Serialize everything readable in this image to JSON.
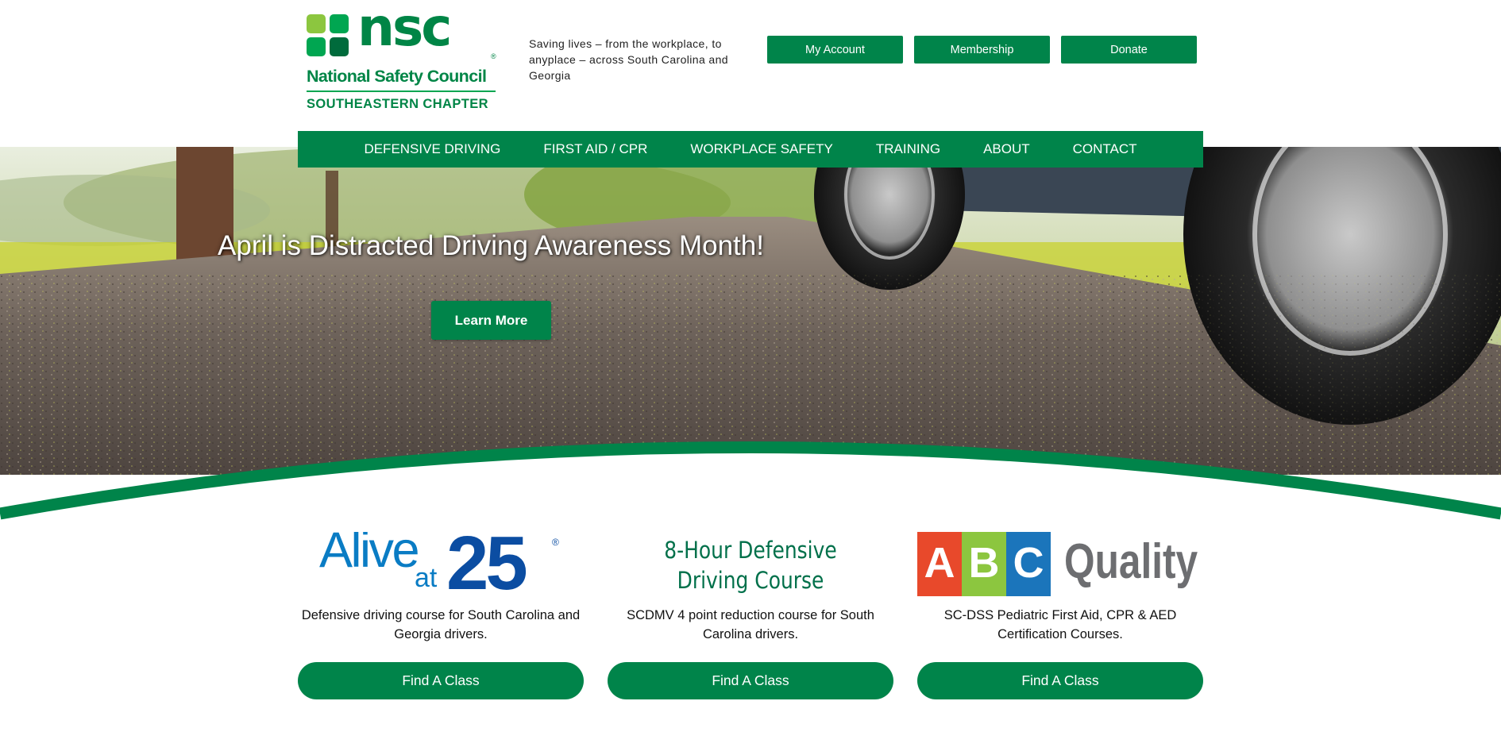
{
  "brand": {
    "wordmark": "nsc",
    "registered": "®",
    "org_name": "National Safety Council",
    "chapter": "SOUTHEASTERN CHAPTER",
    "colors": {
      "primary": "#00844a",
      "light_green": "#8cc63f",
      "dark_green": "#006b3c"
    }
  },
  "header": {
    "tagline": "Saving lives – from the workplace, to anyplace – across South Carolina and Georgia",
    "buttons": [
      "My Account",
      "Membership",
      "Donate"
    ]
  },
  "nav": {
    "items": [
      "DEFENSIVE DRIVING",
      "FIRST AID / CPR",
      "WORKPLACE SAFETY",
      "TRAINING",
      "ABOUT",
      "CONTACT"
    ]
  },
  "hero": {
    "title": "April is Distracted Driving Awareness Month!",
    "button": "Learn More"
  },
  "courses": [
    {
      "logo_icon": "alive-at-25-logo",
      "logo": {
        "word": "Alive",
        "at": "at",
        "number": "25",
        "reg": "®"
      },
      "description": "Defensive driving course for South Carolina and Georgia drivers.",
      "button": "Find A Class"
    },
    {
      "logo_icon": "defensive-driving-logo",
      "logo": {
        "line1": "8-Hour Defensive",
        "line2": "Driving Course"
      },
      "description": "SCDMV 4 point reduction course for South Carolina drivers.",
      "button": "Find A Class"
    },
    {
      "logo_icon": "abc-quality-logo",
      "logo": {
        "a": "A",
        "b": "B",
        "c": "C",
        "word": "Quality"
      },
      "description": "SC-DSS Pediatric First Aid, CPR & AED Certification Courses.",
      "button": "Find A Class"
    }
  ]
}
